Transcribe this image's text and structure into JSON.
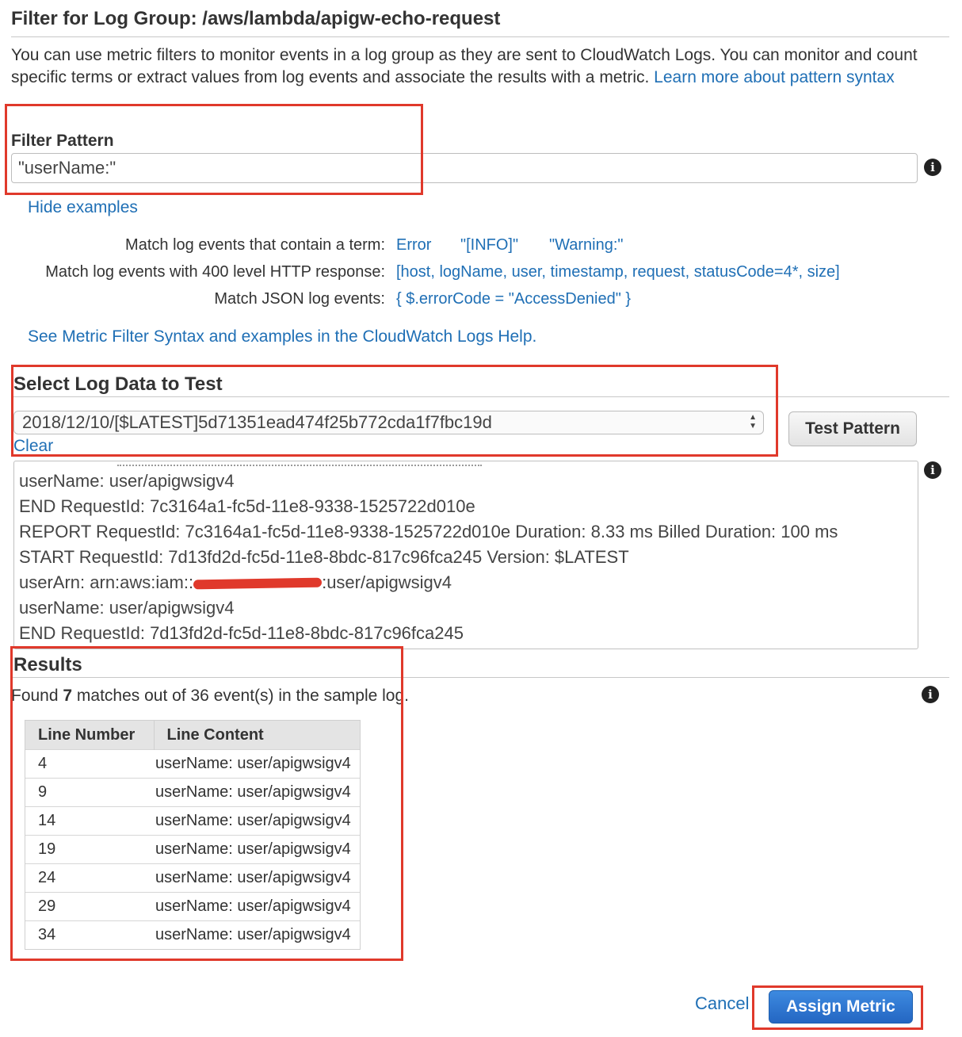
{
  "header": {
    "title": "Filter for Log Group: /aws/lambda/apigw-echo-request"
  },
  "intro": {
    "text": "You can use metric filters to monitor events in a log group as they are sent to CloudWatch Logs. You can monitor and count specific terms or extract values from log events and associate the results with a metric.",
    "link": "Learn more about pattern syntax"
  },
  "filter": {
    "label": "Filter Pattern",
    "value": "\"userName:\""
  },
  "examples": {
    "toggle_link": "Hide examples",
    "rows": [
      {
        "label": "Match log events that contain a term:",
        "values": [
          "Error",
          "\"[INFO]\"",
          "\"Warning:\""
        ]
      },
      {
        "label": "Match log events with 400 level HTTP response:",
        "values": [
          "[host, logName, user, timestamp, request, statusCode=4*, size]"
        ]
      },
      {
        "label": "Match JSON log events:",
        "values": [
          "{ $.errorCode = \"AccessDenied\" }"
        ]
      }
    ],
    "help_link": "See Metric Filter Syntax and examples in the CloudWatch Logs Help."
  },
  "log_data": {
    "section_title": "Select Log Data to Test",
    "selected_stream": "2018/12/10/[$LATEST]5d71351ead474f25b772cda1f7fbc19d",
    "clear_link": "Clear",
    "test_button": "Test Pattern",
    "lines": [
      "userName: user/apigwsigv4",
      "END RequestId: 7c3164a1-fc5d-11e8-9338-1525722d010e",
      "REPORT RequestId: 7c3164a1-fc5d-11e8-9338-1525722d010e Duration: 8.33 ms Billed Duration: 100 ms",
      "START RequestId: 7d13fd2d-fc5d-11e8-8bdc-817c96fca245 Version: $LATEST",
      "userArn: arn:aws:iam::",
      ":user/apigwsigv4",
      "userName: user/apigwsigv4",
      "END RequestId: 7d13fd2d-fc5d-11e8-8bdc-817c96fca245"
    ]
  },
  "results": {
    "section_title": "Results",
    "summary_prefix": "Found",
    "match_count": "7",
    "summary_suffix": "matches out of 36 event(s) in the sample log.",
    "columns": [
      "Line Number",
      "Line Content"
    ],
    "rows": [
      {
        "line": "4",
        "content": "userName: user/apigwsigv4"
      },
      {
        "line": "9",
        "content": "userName: user/apigwsigv4"
      },
      {
        "line": "14",
        "content": "userName: user/apigwsigv4"
      },
      {
        "line": "19",
        "content": "userName: user/apigwsigv4"
      },
      {
        "line": "24",
        "content": "userName: user/apigwsigv4"
      },
      {
        "line": "29",
        "content": "userName: user/apigwsigv4"
      },
      {
        "line": "34",
        "content": "userName: user/apigwsigv4"
      }
    ]
  },
  "footer": {
    "cancel": "Cancel",
    "assign": "Assign Metric"
  },
  "icons": {
    "info": "info-icon"
  },
  "colors": {
    "link": "#1f6fb5",
    "highlight_box": "#e0392b",
    "primary_button": "#2f7bd2",
    "redaction": "#e0392b"
  }
}
